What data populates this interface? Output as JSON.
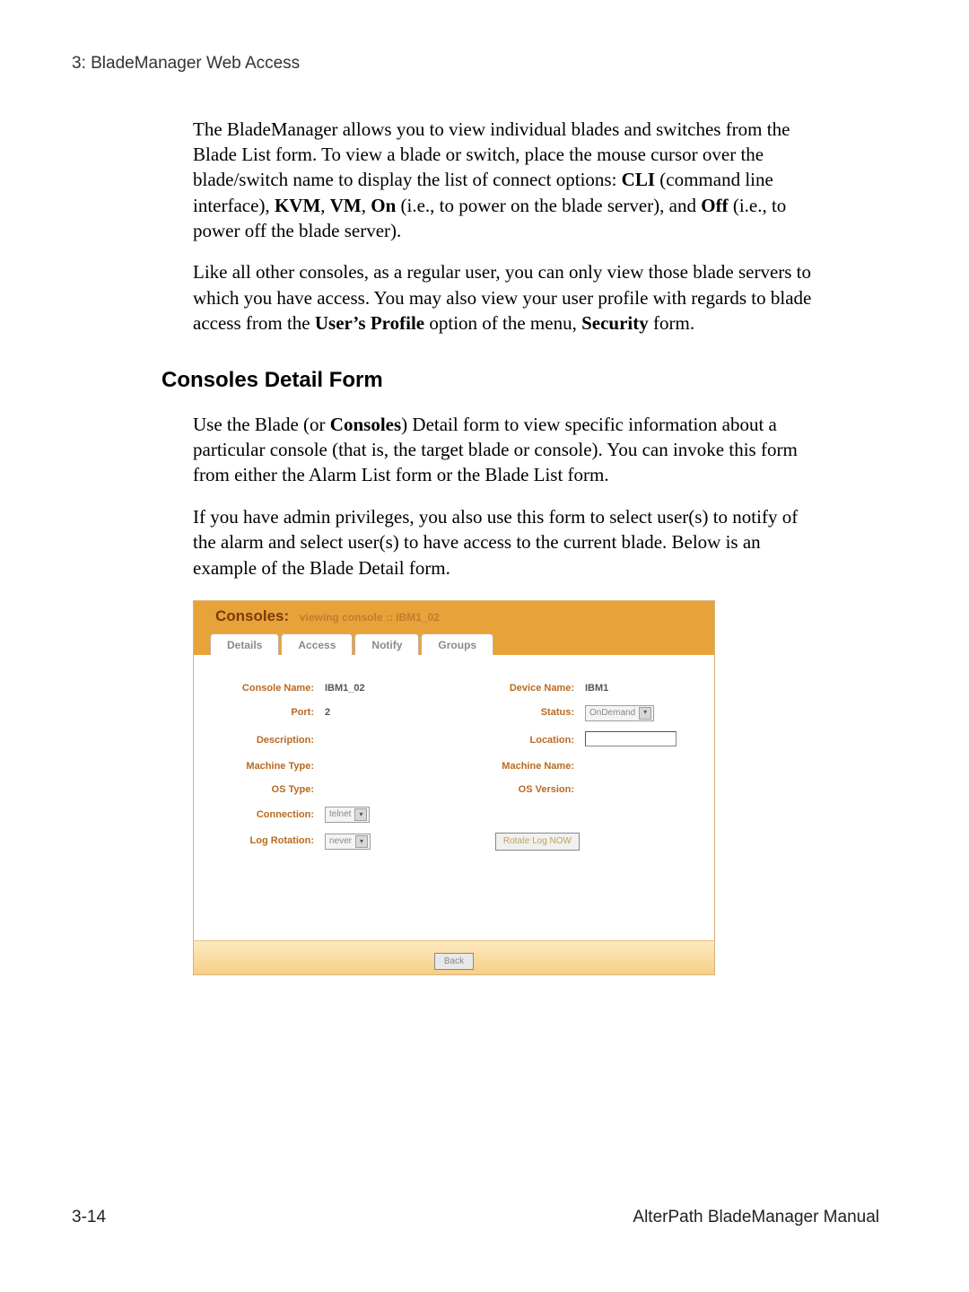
{
  "running_head": "3: BladeManager Web Access",
  "para1_a": "The BladeManager allows you to view individual blades and switches from the Blade List form. To view a blade or switch, place the mouse cursor over the blade/switch name to display the list of connect options: ",
  "para1_cli": "CLI",
  "para1_b": " (command line interface), ",
  "para1_kvm": "KVM",
  "para1_c": ", ",
  "para1_vm": "VM",
  "para1_d": ", ",
  "para1_on": "On",
  "para1_e": " (i.e., to power on the blade server), and ",
  "para1_off": "Off",
  "para1_f": " (i.e., to power off the blade server).",
  "para2_a": "Like all other consoles, as a regular user, you can only view those blade servers to which you have access. You may also view your user profile with regards to blade access from the ",
  "para2_up": "User’s Profile",
  "para2_b": " option of the menu, ",
  "para2_sec": "Security",
  "para2_c": " form.",
  "section_heading": "Consoles Detail Form",
  "para3_a": "Use the Blade (or ",
  "para3_con": "Consoles",
  "para3_b": ") Detail form to view specific information about a particular console (that is, the target blade or console). You can invoke this form from either the Alarm List form or the Blade List form.",
  "para4": "If you have admin privileges, you also use this form to select user(s) to notify of the alarm and select user(s) to have access to the current blade. Below is an example of the Blade Detail form.",
  "figure": {
    "title_main": "Consoles:",
    "title_sub": "viewing console  ::  IBM1_02",
    "tabs": [
      "Details",
      "Access",
      "Notify",
      "Groups"
    ],
    "labels": {
      "console_name": "Console Name:",
      "device_name": "Device Name:",
      "port": "Port:",
      "status": "Status:",
      "description": "Description:",
      "location": "Location:",
      "machine_type": "Machine Type:",
      "machine_name": "Machine Name:",
      "os_type": "OS Type:",
      "os_version": "OS Version:",
      "connection": "Connection:",
      "log_rotation": "Log Rotation:"
    },
    "values": {
      "console_name": "IBM1_02",
      "device_name": "IBM1",
      "port": "2",
      "status": "OnDemand",
      "connection": "telnet",
      "log_rotation": "never"
    },
    "buttons": {
      "rotate": "Rotate Log NOW",
      "back": "Back"
    }
  },
  "footer": {
    "left": "3-14",
    "right": "AlterPath BladeManager Manual"
  }
}
